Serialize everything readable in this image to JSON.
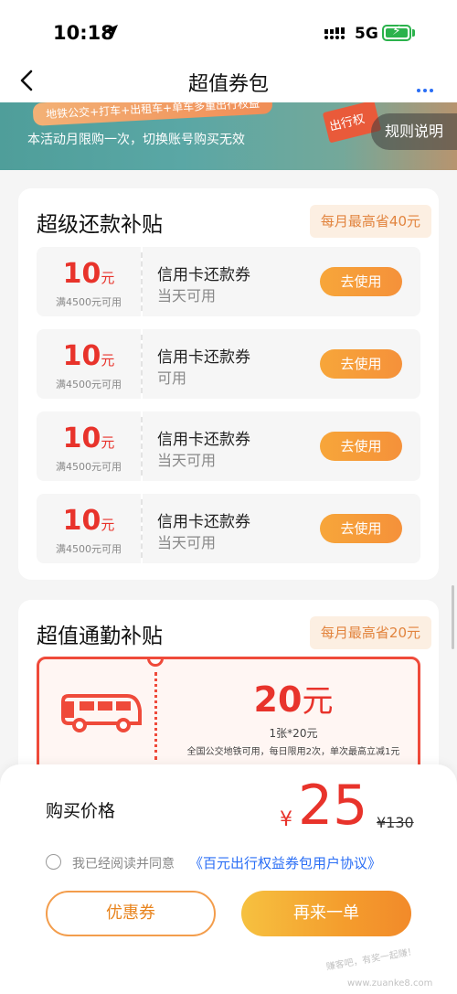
{
  "status_bar": {
    "time": "10:18",
    "network": "5G"
  },
  "nav": {
    "title": "超值券包"
  },
  "banner": {
    "tagline": "地铁公交+打车+出租车+单车多重出行权益",
    "notice": "本活动月限购一次，切换账号购买无效",
    "ticket_text": "出行权",
    "rules_button": "规则说明"
  },
  "sections": [
    {
      "title": "超级还款补贴",
      "badge": "每月最高省40元",
      "coupons": [
        {
          "amount": "10",
          "unit": "元",
          "condition": "满4500元可用",
          "name": "信用卡还款券",
          "availability": "当天可用",
          "action": "去使用"
        },
        {
          "amount": "10",
          "unit": "元",
          "condition": "满4500元可用",
          "name": "信用卡还款券",
          "availability": "可用",
          "action": "去使用"
        },
        {
          "amount": "10",
          "unit": "元",
          "condition": "满4500元可用",
          "name": "信用卡还款券",
          "availability": "当天可用",
          "action": "去使用"
        },
        {
          "amount": "10",
          "unit": "元",
          "condition": "满4500元可用",
          "name": "信用卡还款券",
          "availability": "当天可用",
          "action": "去使用"
        }
      ]
    },
    {
      "title": "超值通勤补贴",
      "badge": "每月最高省20元",
      "commute_coupon": {
        "amount": "20",
        "unit": "元",
        "spec": "1张*20元",
        "description": "全国公交地铁可用，每日限用2次，单次最高立减1元"
      }
    }
  ],
  "purchase": {
    "label": "购买价格",
    "currency": "¥",
    "price": "25",
    "original_price": "¥130",
    "agreement_prefix": "我已经阅读并同意",
    "agreement_link": "《百元出行权益券包用户协议》",
    "coupon_button": "优惠券",
    "buy_again_button": "再来一单",
    "watermark": "赚客吧，有奖一起赚！",
    "watermark_url": "www.zuanke8.com"
  },
  "colors": {
    "accent_red": "#e8332b",
    "accent_orange": "#f5913a",
    "link_blue": "#2a6ef5"
  }
}
